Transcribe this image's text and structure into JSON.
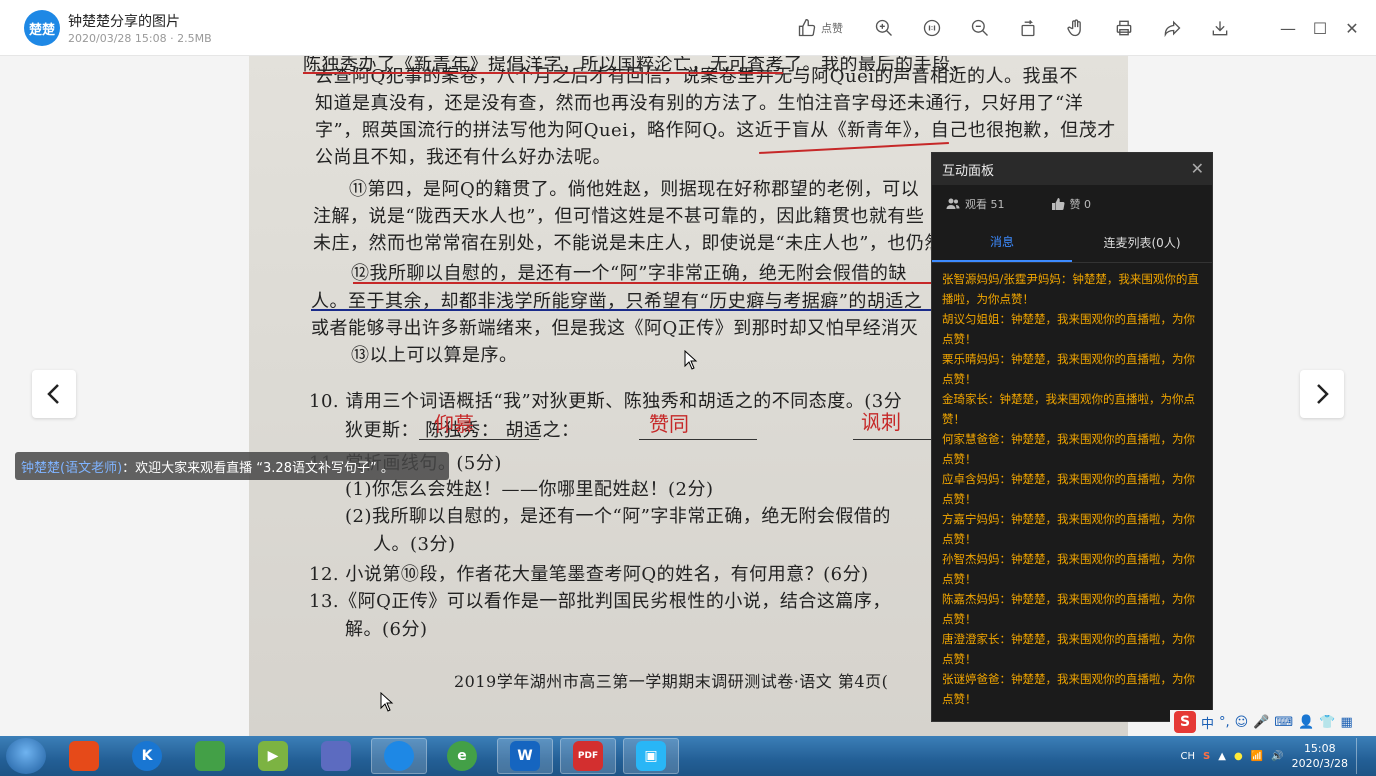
{
  "titlebar": {
    "logo_text": "楚楚",
    "title": "钟楚楚分享的图片",
    "meta": "2020/03/28 15:08 · 2.5MB",
    "like_label": "点赞"
  },
  "photo": {
    "lines": [
      "陈独秀办了《新青年》提倡洋字，所以国粹沦亡，无可查考了。我的最后的手段，",
      "去查阿Q犯事的案卷，八个月之后才有回信，说案卷里并无与阿Quei的声音相近的人。我虽不",
      "知道是真没有，还是没有查，然而也再没有别的方法了。生怕注音字母还未通行，只好用了“洋",
      "字”，照英国流行的拼法写他为阿Quei，略作阿Q。这近于盲从《新青年》，自己也很抱歉，但茂才",
      "公尚且不知，我还有什么好办法呢。",
      "⑪第四，是阿Q的籍贯了。倘他姓赵，则据现在好称郡望的老例，可以",
      "注解，说是“陇西天水人也”，但可惜这姓是不甚可靠的，因此籍贯也就有些",
      "未庄，然而也常常宿在别处，不能说是未庄人，即使说是“未庄人也”，也仍然",
      "⑫我所聊以自慰的，是还有一个“阿”字非常正确，绝无附会假借的缺",
      "人。至于其余，却都非浅学所能穿凿，只希望有“历史癖与考据癖”的胡适之",
      "或者能够寻出许多新端绪来，但是我这《阿Q正传》到那时却又怕早经消灭",
      "⑬以上可以算是序。",
      "10. 请用三个词语概括“我”对狄更斯、陈独秀和胡适之的不同态度。(3分",
      "狄更斯：                    陈独秀：                    胡适之：",
      "11. 赏析画线句。(5分)",
      "(1)你怎么会姓赵！——你哪里配姓赵！(2分)",
      "(2)我所聊以自慰的，是还有一个“阿”字非常正确，绝无附会假借的",
      "人。(3分)",
      "12. 小说第⑩段，作者花大量笔墨查考阿Q的姓名，有何用意？(6分)",
      "13.《阿Q正传》可以看作是一部批判国民劣根性的小说，结合这篇序，",
      "解。(6分)",
      "2019学年湖州市高三第一学期期末调研测试卷·语文    第4页("
    ],
    "hand_answers": [
      "仰慕",
      "赞同",
      "讽刺"
    ]
  },
  "banner": {
    "who": "钟楚楚(语文老师)",
    "text": "：欢迎大家来观看直播 “3.28语文补写句子” 。"
  },
  "panel": {
    "title": "互动面板",
    "viewers": "观看 51",
    "likes": "赞 0",
    "tabs": [
      "消息",
      "连麦列表(0人)"
    ],
    "messages": [
      "张智源妈妈/张霆尹妈妈：钟楚楚，我来围观你的直播啦，为你点赞！",
      "胡议匀姐姐：钟楚楚，我来围观你的直播啦，为你点赞！",
      "栗乐晴妈妈：钟楚楚，我来围观你的直播啦，为你点赞！",
      "金琦家长：钟楚楚，我来围观你的直播啦，为你点赞！",
      "何家慧爸爸：钟楚楚，我来围观你的直播啦，为你点赞！",
      "应卓含妈妈：钟楚楚，我来围观你的直播啦，为你点赞！",
      "方嘉宁妈妈：钟楚楚，我来围观你的直播啦，为你点赞！",
      "孙智杰妈妈：钟楚楚，我来围观你的直播啦，为你点赞！",
      "陈嘉杰妈妈：钟楚楚，我来围观你的直播啦，为你点赞！",
      "唐澄澄家长：钟楚楚，我来围观你的直播啦，为你点赞！",
      "张谜婷爸爸：钟楚楚，我来围观你的直播啦，为你点赞！"
    ]
  },
  "ime": {
    "brand": "S",
    "mode": "中"
  },
  "taskbar": {
    "apps": [
      "K",
      "W",
      "PDF"
    ],
    "tray_lang": "CH",
    "time": "15:08",
    "date": "2020/3/28"
  },
  "colors": {
    "accent": "#3d8bff",
    "message": "#f0a500",
    "ink_red": "#c62828"
  }
}
